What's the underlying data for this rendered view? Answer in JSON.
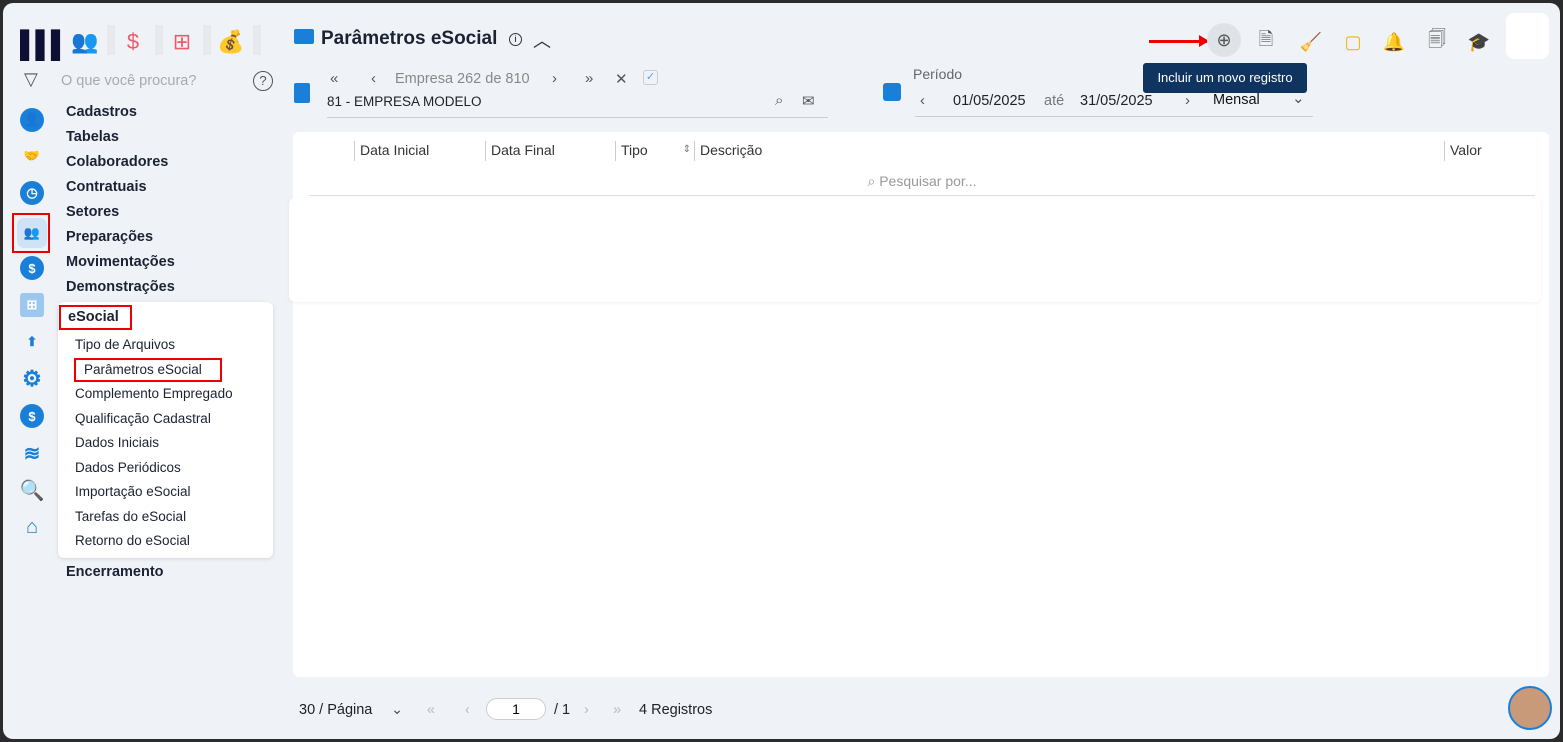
{
  "topbar": {
    "search_placeholder": "O que você procura?"
  },
  "menu": {
    "items": [
      "Cadastros",
      "Tabelas",
      "Colaboradores",
      "Contratuais",
      "Setores",
      "Preparações",
      "Movimentações",
      "Demonstrações"
    ],
    "esocial": "eSocial",
    "esocial_items": [
      "Tipo de Arquivos",
      "Parâmetros eSocial",
      "Complemento Empregado",
      "Qualificação Cadastral",
      "Dados Iniciais",
      "Dados Periódicos",
      "Importação eSocial",
      "Tarefas do eSocial",
      "Retorno do eSocial"
    ],
    "last": "Encerramento"
  },
  "header": {
    "title": "Parâmetros eSocial",
    "empresa_nav": "Empresa 262 de 810",
    "empresa": "81 - EMPRESA MODELO",
    "periodo_label": "Período",
    "date_from": "01/05/2025",
    "ate": "até",
    "date_to": "31/05/2025",
    "period_type": "Mensal",
    "tooltip": "Incluir um novo registro"
  },
  "table": {
    "columns": [
      "Data Inicial",
      "Data Final",
      "Tipo",
      "Descrição",
      "Valor"
    ],
    "search_placeholder": "Pesquisar por..."
  },
  "pagination": {
    "per_page": "30 / Página",
    "page": "1",
    "total_pages": "/ 1",
    "records": "4 Registros"
  },
  "colors": {
    "accent": "#1a7fd8",
    "highlight": "#e00000",
    "tooltip": "#0f3460"
  }
}
